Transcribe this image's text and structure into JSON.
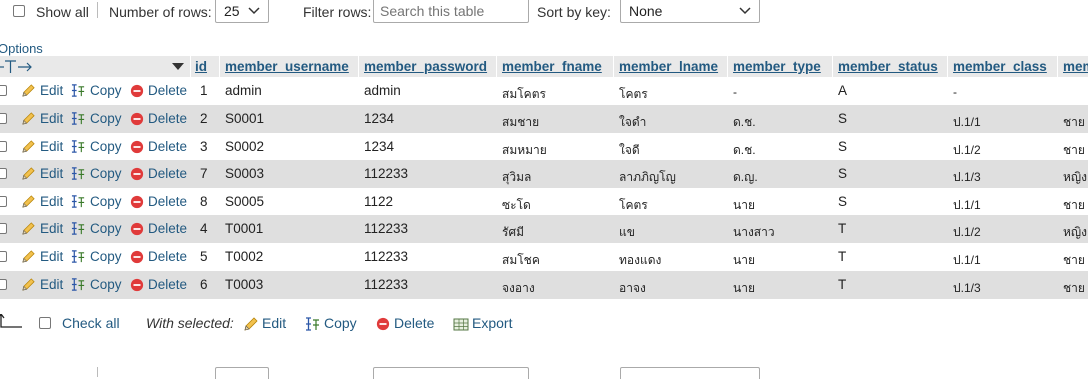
{
  "top_bar": {
    "show_all_label": "Show all",
    "rows_label": "Number of rows:",
    "rows_value": "25",
    "filter_label": "Filter rows:",
    "filter_placeholder": "Search this table",
    "sort_label": "Sort by key:",
    "sort_value": "None"
  },
  "options_label": "Options",
  "columns": [
    "id",
    "member_username",
    "member_password",
    "member_fname",
    "member_lname",
    "member_type",
    "member_status",
    "member_class",
    "mem"
  ],
  "row_actions": {
    "edit": "Edit",
    "copy": "Copy",
    "delete": "Delete"
  },
  "rows": [
    {
      "id": "1",
      "username": "admin",
      "password": "admin",
      "fname": "สมโคตร",
      "lname": "โคตร",
      "type": "-",
      "status": "A",
      "class": "-",
      "extra": ""
    },
    {
      "id": "2",
      "username": "S0001",
      "password": "1234",
      "fname": "สมชาย",
      "lname": "ใจดำ",
      "type": "ด.ช.",
      "status": "S",
      "class": "ป.1/1",
      "extra": "ชาย"
    },
    {
      "id": "3",
      "username": "S0002",
      "password": "1234",
      "fname": "สมหมาย",
      "lname": "ใจดี",
      "type": "ด.ช.",
      "status": "S",
      "class": "ป.1/2",
      "extra": "ชาย"
    },
    {
      "id": "7",
      "username": "S0003",
      "password": "112233",
      "fname": "สุวิมล",
      "lname": "ลาภภิญโญ",
      "type": "ด.ญ.",
      "status": "S",
      "class": "ป.1/3",
      "extra": "หญิง"
    },
    {
      "id": "8",
      "username": "S0005",
      "password": "1122",
      "fname": "ซะโด",
      "lname": "โคตร",
      "type": "นาย",
      "status": "S",
      "class": "ป.1/1",
      "extra": "ชาย"
    },
    {
      "id": "4",
      "username": "T0001",
      "password": "112233",
      "fname": "รัศมี",
      "lname": "แข",
      "type": "นางสาว",
      "status": "T",
      "class": "ป.1/2",
      "extra": "หญิง"
    },
    {
      "id": "5",
      "username": "T0002",
      "password": "112233",
      "fname": "สมโชค",
      "lname": "ทองแดง",
      "type": "นาย",
      "status": "T",
      "class": "ป.1/1",
      "extra": "ชาย"
    },
    {
      "id": "6",
      "username": "T0003",
      "password": "112233",
      "fname": "จงอาง",
      "lname": "อาจง",
      "type": "นาย",
      "status": "T",
      "class": "ป.1/3",
      "extra": "ชาย"
    }
  ],
  "bulk": {
    "check_all": "Check all",
    "with_selected": "With selected:",
    "edit": "Edit",
    "copy": "Copy",
    "delete": "Delete",
    "export": "Export"
  },
  "colors": {
    "link": "#235a81",
    "header_bg": "#e9e9e9",
    "row_alt_bg": "#dfdfdf"
  }
}
